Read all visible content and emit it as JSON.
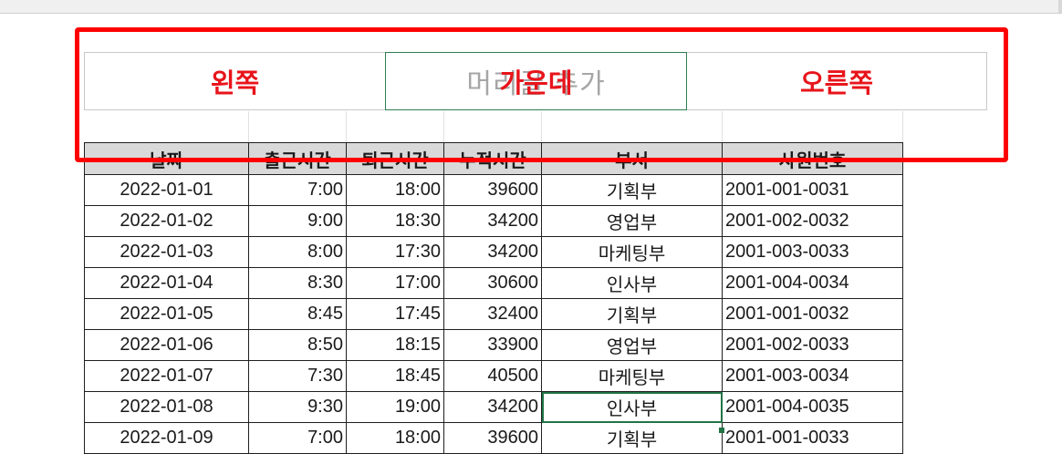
{
  "header": {
    "left": "왼쪽",
    "center": "가운데",
    "center_placeholder": "머리글 추가",
    "right": "오른쪽"
  },
  "table": {
    "columns": [
      "날짜",
      "출근시간",
      "퇴근시간",
      "누적시간",
      "부서",
      "사원번호"
    ],
    "rows": [
      [
        "2022-01-01",
        "7:00",
        "18:00",
        "39600",
        "기획부",
        "2001-001-0031"
      ],
      [
        "2022-01-02",
        "9:00",
        "18:30",
        "34200",
        "영업부",
        "2001-002-0032"
      ],
      [
        "2022-01-03",
        "8:00",
        "17:30",
        "34200",
        "마케팅부",
        "2001-003-0033"
      ],
      [
        "2022-01-04",
        "8:30",
        "17:00",
        "30600",
        "인사부",
        "2001-004-0034"
      ],
      [
        "2022-01-05",
        "8:45",
        "17:45",
        "32400",
        "기획부",
        "2001-001-0032"
      ],
      [
        "2022-01-06",
        "8:50",
        "18:15",
        "33900",
        "영업부",
        "2001-002-0033"
      ],
      [
        "2022-01-07",
        "7:30",
        "18:45",
        "40500",
        "마케팅부",
        "2001-003-0034"
      ],
      [
        "2022-01-08",
        "9:30",
        "19:00",
        "34200",
        "인사부",
        "2001-004-0035"
      ],
      [
        "2022-01-09",
        "7:00",
        "18:00",
        "39600",
        "기획부",
        "2001-001-0033"
      ]
    ]
  },
  "colors": {
    "annotation": "#ff0000",
    "header_text": "#e8141b",
    "selection": "#217346",
    "header_fill": "#d9d9d9"
  }
}
